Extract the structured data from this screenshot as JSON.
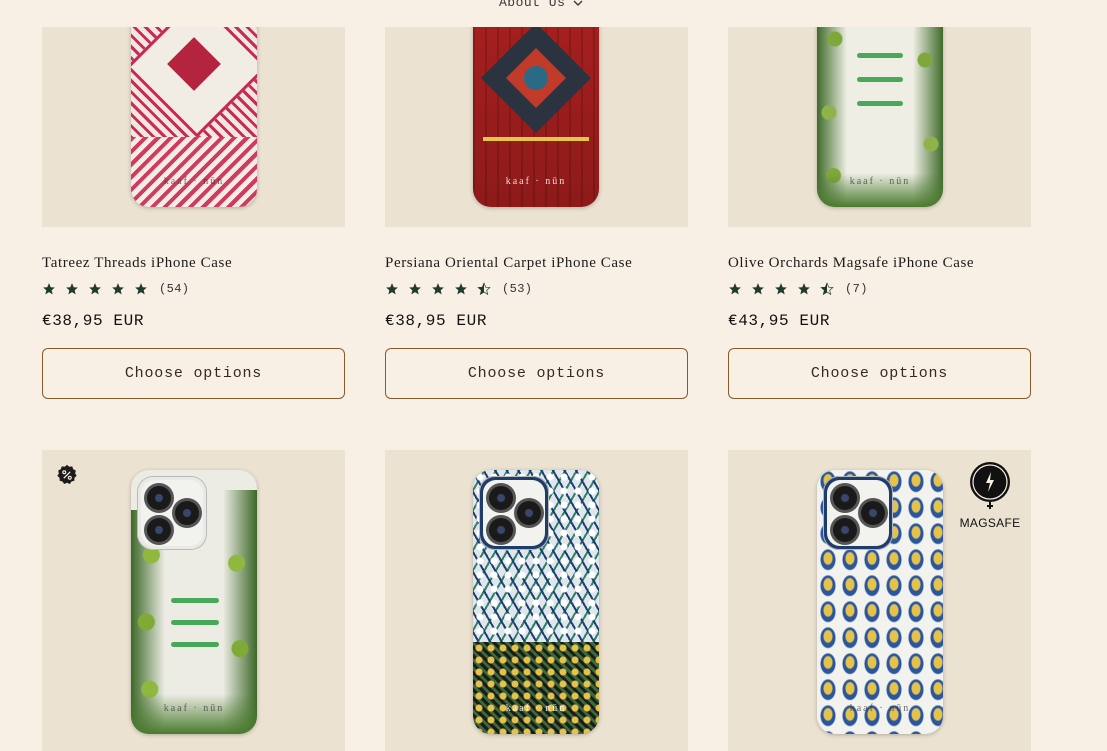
{
  "nav": {
    "about_label": "About Us"
  },
  "products": [
    {
      "title": "Tatreez Threads iPhone Case",
      "rating": 5.0,
      "reviews": "(54)",
      "price": "€38,95 EUR",
      "button": "Choose options"
    },
    {
      "title": "Persiana Oriental Carpet iPhone Case",
      "rating": 4.5,
      "reviews": "(53)",
      "price": "€38,95 EUR",
      "button": "Choose options"
    },
    {
      "title": "Olive Orchards Magsafe iPhone Case",
      "rating": 4.5,
      "reviews": "(7)",
      "price": "€43,95 EUR",
      "button": "Choose options"
    }
  ],
  "second_row": {
    "brand_mark": "kaaf · nūn",
    "magsafe_label": "MAGSAFE"
  },
  "icons": {
    "sale": "percent-badge-icon",
    "magsafe": "magsafe-charge-icon",
    "star": "star-icon",
    "chevron": "chevron-down-icon"
  },
  "colors": {
    "background": "#f8f0e4",
    "card_bg": "#ece2d2",
    "star": "#1f3a2a",
    "button_border": "#8a5a2e"
  }
}
